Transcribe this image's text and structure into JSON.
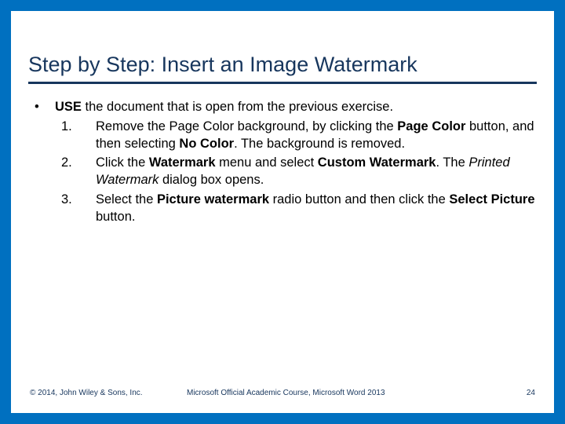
{
  "title": "Step by Step: Insert an Image Watermark",
  "bullet": {
    "mark": "•",
    "lead_bold": "USE",
    "lead_rest": " the document that is open from the previous exercise."
  },
  "steps": [
    {
      "num": "1.",
      "parts": [
        {
          "t": "Remove the Page Color background, by clicking the ",
          "b": false,
          "i": false
        },
        {
          "t": "Page Color",
          "b": true,
          "i": false
        },
        {
          "t": " button, and then selecting ",
          "b": false,
          "i": false
        },
        {
          "t": "No Color",
          "b": true,
          "i": false
        },
        {
          "t": ". The background is removed.",
          "b": false,
          "i": false
        }
      ]
    },
    {
      "num": "2.",
      "parts": [
        {
          "t": "Click the ",
          "b": false,
          "i": false
        },
        {
          "t": "Watermark",
          "b": true,
          "i": false
        },
        {
          "t": " menu and select ",
          "b": false,
          "i": false
        },
        {
          "t": "Custom Watermark",
          "b": true,
          "i": false
        },
        {
          "t": ". The ",
          "b": false,
          "i": false
        },
        {
          "t": "Printed Watermark",
          "b": false,
          "i": true
        },
        {
          "t": " dialog box opens.",
          "b": false,
          "i": false
        }
      ]
    },
    {
      "num": "3.",
      "parts": [
        {
          "t": "Select the ",
          "b": false,
          "i": false
        },
        {
          "t": "Picture watermark",
          "b": true,
          "i": false
        },
        {
          "t": " radio button and then click the ",
          "b": false,
          "i": false
        },
        {
          "t": "Select Picture",
          "b": true,
          "i": false
        },
        {
          "t": " button.",
          "b": false,
          "i": false
        }
      ]
    }
  ],
  "footer": {
    "left": "© 2014, John Wiley & Sons, Inc.",
    "center": "Microsoft Official Academic Course, Microsoft Word 2013",
    "right": "24"
  }
}
